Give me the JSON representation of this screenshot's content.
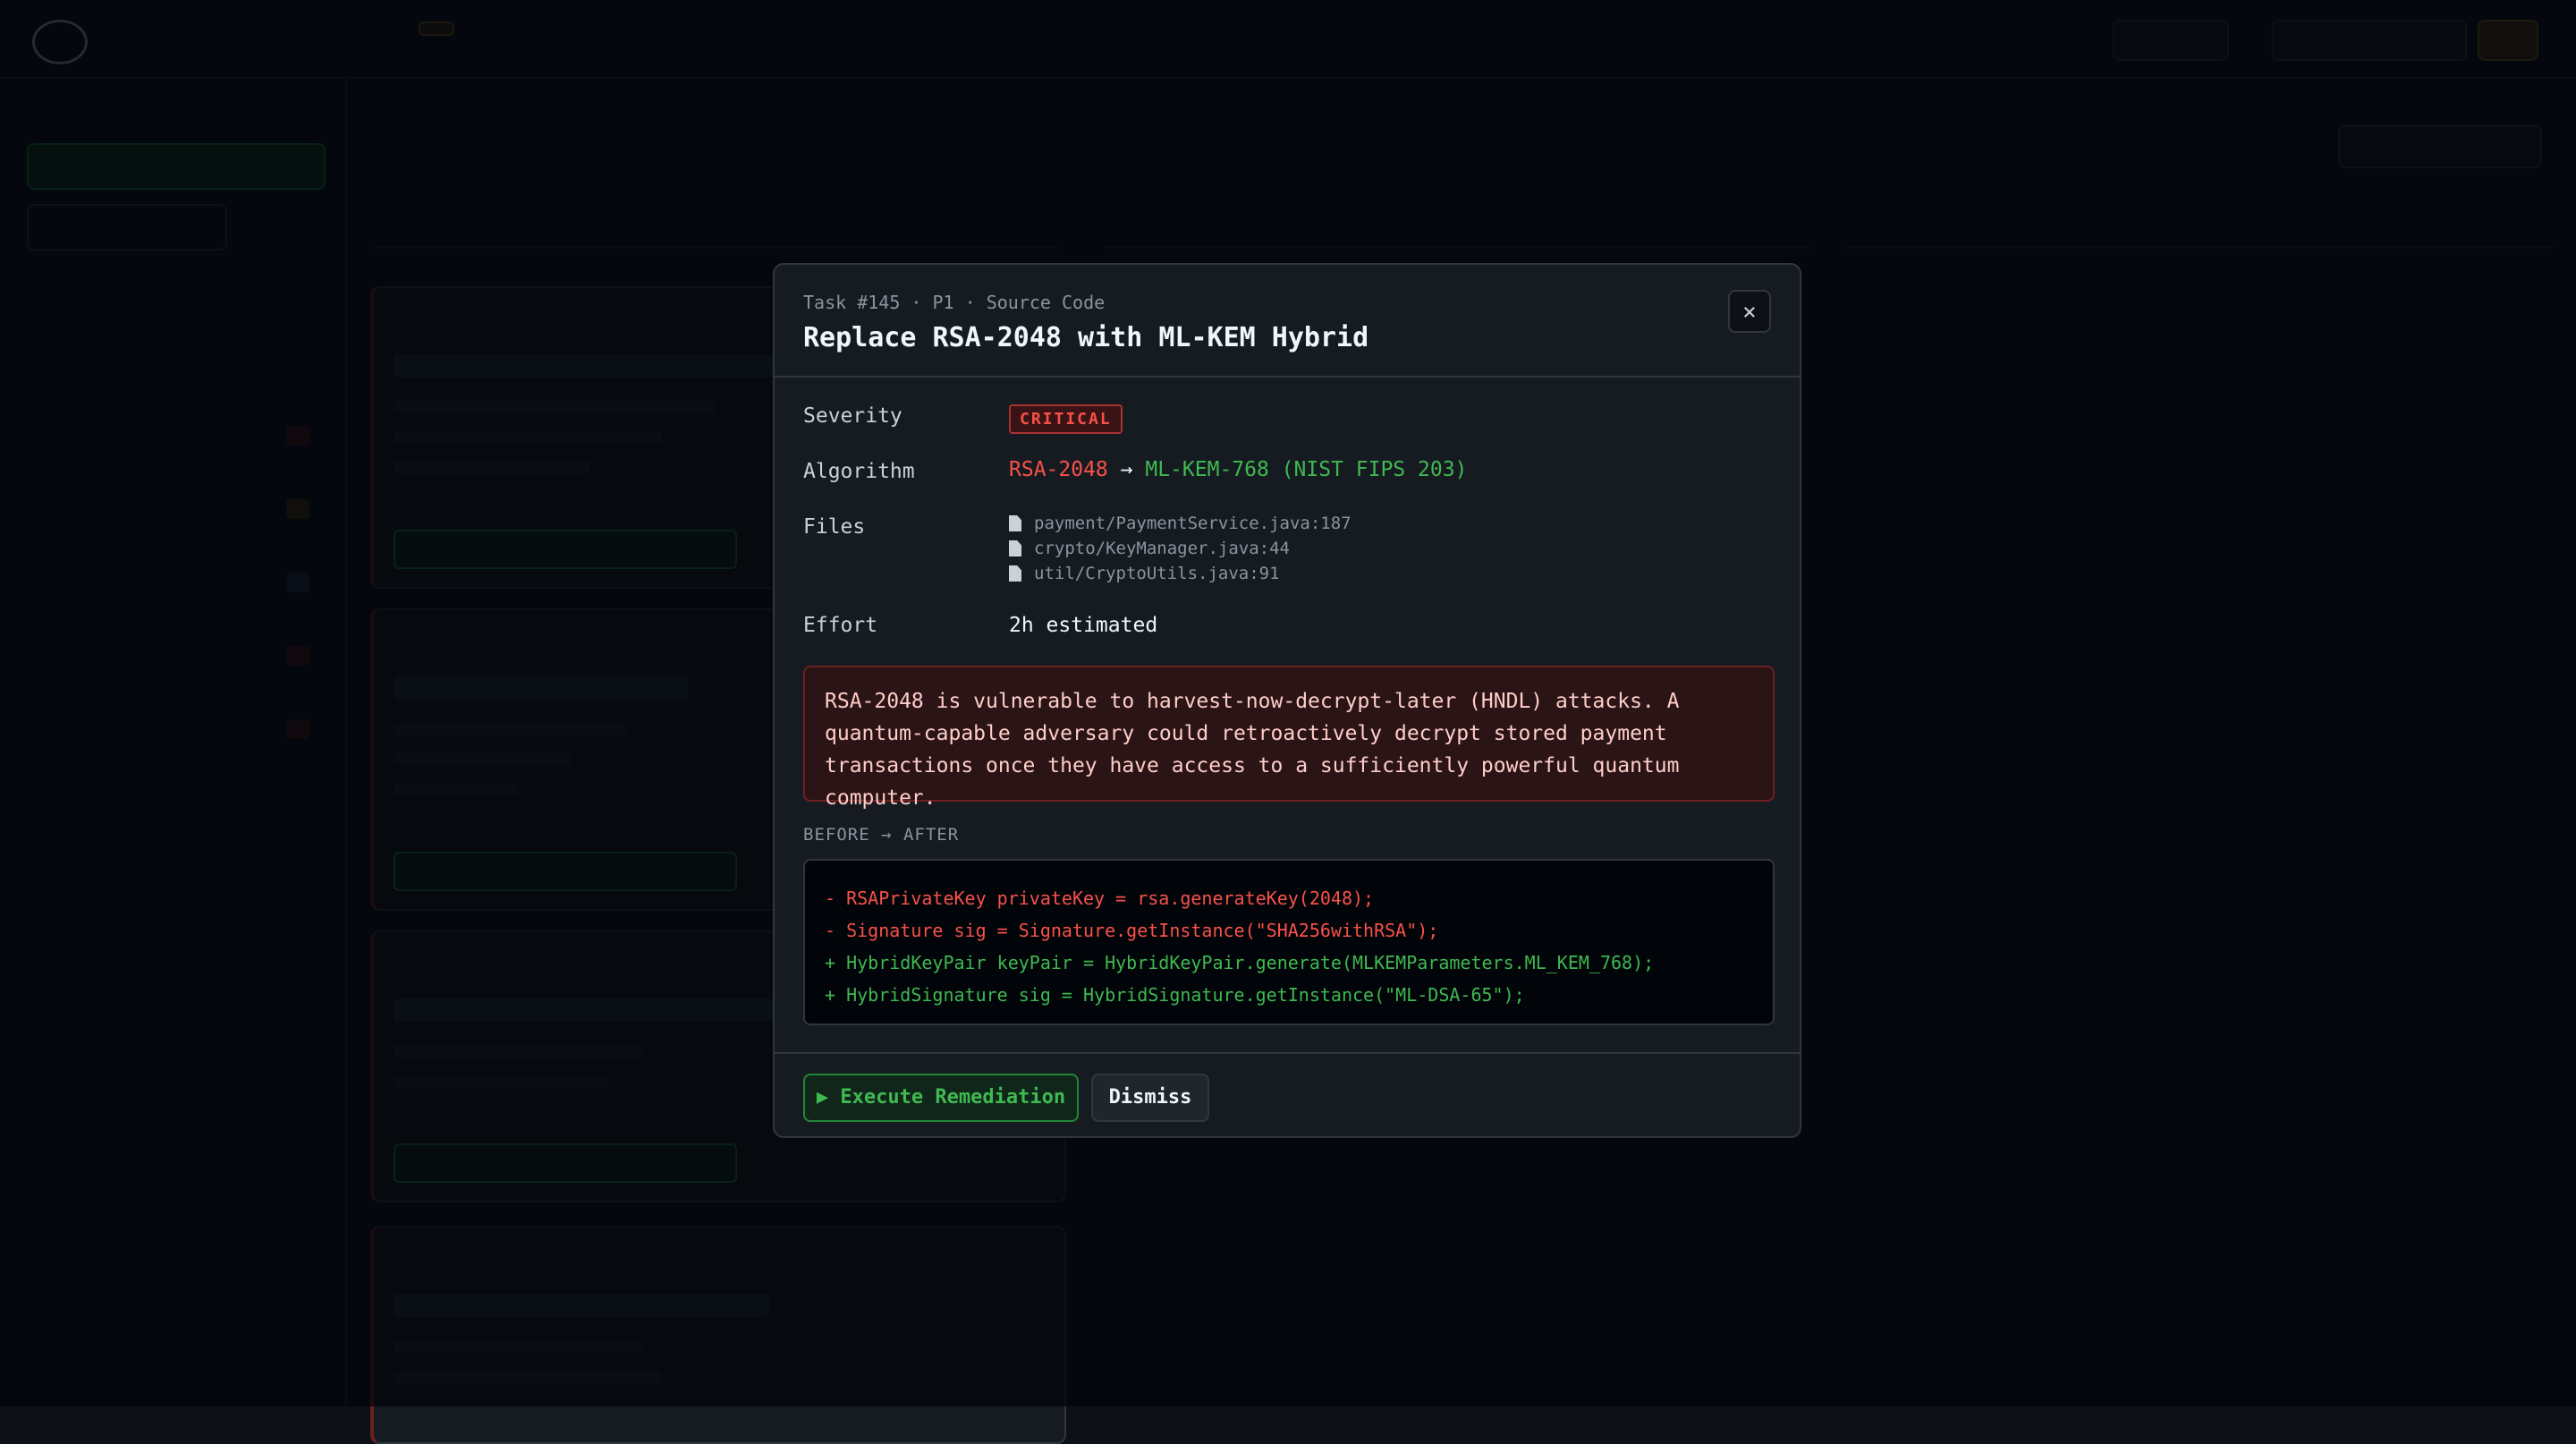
{
  "modal": {
    "meta": "Task #145 · P1 · Source Code",
    "title": "Replace RSA-2048 with ML-KEM Hybrid",
    "close_glyph": "×",
    "severity_label": "Severity",
    "severity_value": "CRITICAL",
    "algorithm_label": "Algorithm",
    "algorithm_from": "RSA-2048",
    "algorithm_arrow": "→",
    "algorithm_to": "ML-KEM-768 (NIST FIPS 203)",
    "files_label": "Files",
    "files": [
      "payment/PaymentService.java:187",
      "crypto/KeyManager.java:44",
      "util/CryptoUtils.java:91"
    ],
    "effort_label": "Effort",
    "effort_value": "2h estimated",
    "warning": "RSA-2048 is vulnerable to harvest-now-decrypt-later (HNDL) attacks. A quantum-capable adversary could retroactively decrypt stored payment transactions once they have access to a sufficiently powerful quantum computer.",
    "before_after_label": "BEFORE → AFTER",
    "code_lines": [
      "- RSAPrivateKey privateKey = rsa.generateKey(2048);",
      "- Signature sig = Signature.getInstance(\"SHA256withRSA\");",
      "+ HybridKeyPair keyPair = HybridKeyPair.generate(MLKEMParameters.ML_KEM_768);",
      "+ HybridSignature sig = HybridSignature.getInstance(\"ML-DSA-65\");"
    ],
    "execute_label": "▶ Execute Remediation",
    "dismiss_label": "Dismiss"
  },
  "colors": {
    "critical": "#f85149",
    "success": "#3fb950",
    "background": "#0d1117",
    "panel": "#161b22"
  },
  "icons": [
    "close-icon",
    "file-icon",
    "play-icon"
  ]
}
